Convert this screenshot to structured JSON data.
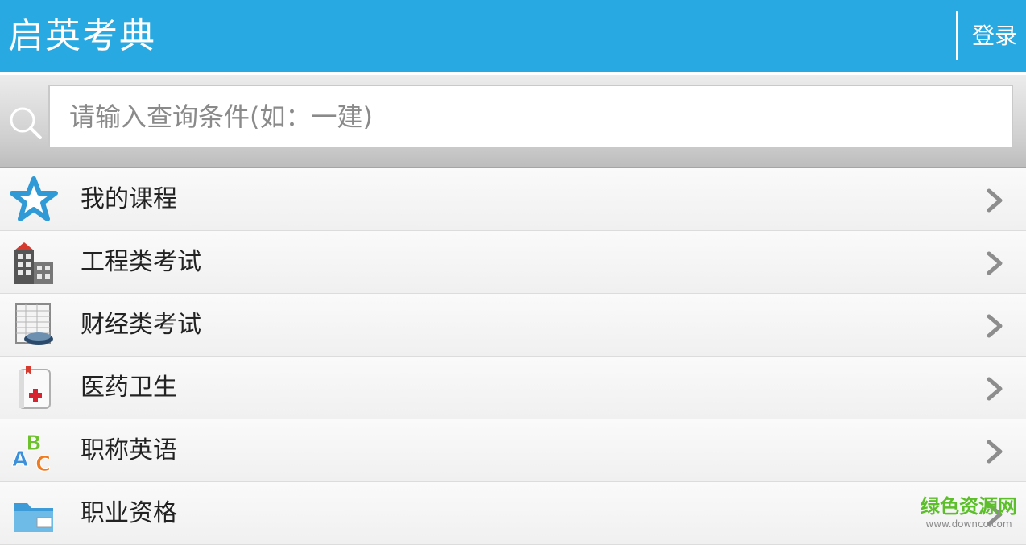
{
  "header": {
    "title": "启英考典",
    "login_label": "登录"
  },
  "search": {
    "placeholder": "请输入查询条件(如：一建)"
  },
  "menu": [
    {
      "label": "我的课程",
      "icon": "star-icon"
    },
    {
      "label": "工程类考试",
      "icon": "building-icon"
    },
    {
      "label": "财经类考试",
      "icon": "spreadsheet-icon"
    },
    {
      "label": "医药卫生",
      "icon": "medical-book-icon"
    },
    {
      "label": "职称英语",
      "icon": "abc-letters-icon"
    },
    {
      "label": "职业资格",
      "icon": "folder-icon"
    }
  ],
  "watermark": {
    "title": "绿色资源网",
    "url": "www.downcc.com"
  },
  "colors": {
    "header_bg": "#29a9e1",
    "watermark": "#5cbf2a",
    "star_blue": "#2f9ad6"
  }
}
